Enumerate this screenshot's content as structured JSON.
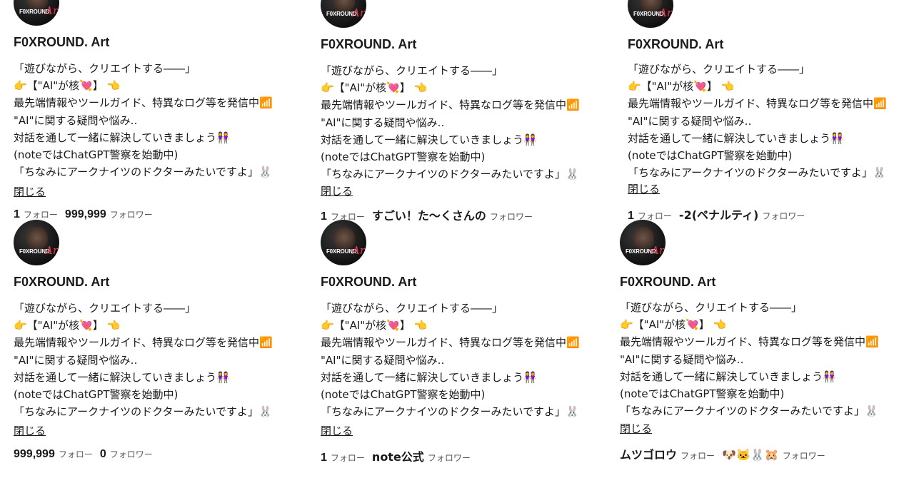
{
  "profile": {
    "name": "F0XROUND. Art",
    "avatar_logo": "F0XROUND",
    "avatar_logo_script": "Art",
    "bio": [
      "「遊びながら、クリエイトする――」",
      "👉【\"AI\"が核💘】 👈",
      "最先端情報やツールガイド、特異なログ等を発信中📶",
      "\"AI\"に関する疑問や悩み‥",
      "対話を通して一緒に解決していきましょう👭",
      "(noteではChatGPT警察を始動中)",
      "「ちなみにアークナイツのドクターみたいですよ」🐰"
    ],
    "close_label": "閉じる",
    "follow_label": "フォロー",
    "follower_label": "フォロワー"
  },
  "cards": [
    {
      "following": "1",
      "followers": "999,999"
    },
    {
      "following": "1",
      "followers": "すごい！た〜くさんの"
    },
    {
      "following": "1",
      "followers": "-2(ペナルティ)"
    },
    {
      "following": "999,999",
      "followers": "0"
    },
    {
      "following": "1",
      "followers": "note公式"
    },
    {
      "following": "ムツゴロウ",
      "followers": "🐶🐱🐰🐹"
    }
  ],
  "colors": {
    "text": "#1a1a1a",
    "muted": "#555555",
    "accent": "#e8364f"
  }
}
